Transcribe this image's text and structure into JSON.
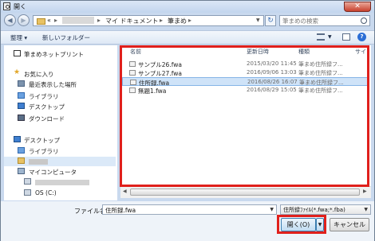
{
  "window": {
    "title": "開く",
    "close_glyph": "✕"
  },
  "address": {
    "crumbs": [
      "«",
      "▸",
      "マイ ドキュメント",
      "▸",
      "筆まめ",
      "▸"
    ],
    "search_placeholder": "筆まめの検索"
  },
  "toolbar": {
    "organize_label": "整理 ▾",
    "new_folder_label": "新しいフォルダー",
    "help_label": "?"
  },
  "nav": {
    "items": [
      {
        "label": "筆まめネットプリント",
        "icon": "netprint-icon"
      },
      {
        "label": "お気に入り",
        "icon": "star-icon"
      },
      {
        "label": "最近表示した場所",
        "icon": "recent-places-icon"
      },
      {
        "label": "ライブラリ",
        "icon": "library-icon"
      },
      {
        "label": "デスクトップ",
        "icon": "desktop-icon"
      },
      {
        "label": "ダウンロード",
        "icon": "download-icon"
      },
      {
        "label": "デスクトップ",
        "icon": "desktop-icon"
      },
      {
        "label": "ライブラリ",
        "icon": "library-icon"
      },
      {
        "label": "マイコンピュータ",
        "icon": "computer-icon"
      },
      {
        "label": "OS (C:)",
        "icon": "drive-icon"
      }
    ]
  },
  "columns": {
    "name": "名前",
    "date": "更新日時",
    "type": "種類",
    "size": "サイ"
  },
  "files": [
    {
      "name": "サンプル26.fwa",
      "date": "2015/03/20 11:45",
      "type": "筆まめ住所録フ..."
    },
    {
      "name": "サンプル27.fwa",
      "date": "2016/09/06 13:03",
      "type": "筆まめ住所録フ..."
    },
    {
      "name": "住所録.fwa",
      "date": "2016/08/26 16:07",
      "type": "筆まめ住所録フ..."
    },
    {
      "name": "無題1.fwa",
      "date": "2016/08/29 15:05",
      "type": "筆まめ住所録フ..."
    }
  ],
  "filename": {
    "label": "ファイル名(N):",
    "value": "住所録.fwa"
  },
  "filetype": {
    "value": "住所録ﾌｧｲﾙ(*.fwa;*.fba)"
  },
  "buttons": {
    "open_label": "開く(O)",
    "cancel_label": "キャンセル"
  },
  "colors": {
    "highlight": "#e0201c",
    "selection": "#cfe3f8",
    "frame": "#c9d9ee"
  }
}
